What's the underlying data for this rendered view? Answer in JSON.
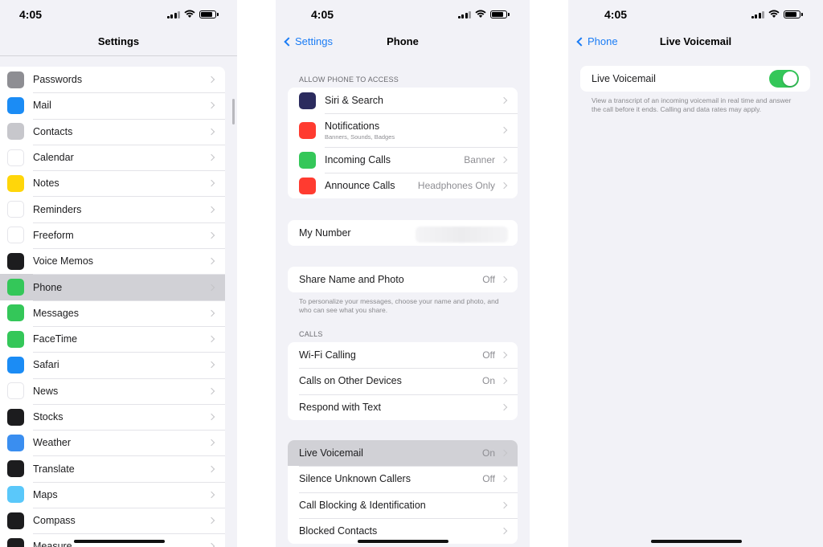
{
  "colors": {
    "accent": "#1a7cf5",
    "toggle_on": "#34c759",
    "highlight": "#d1d1d6"
  },
  "status": {
    "time": "4:05"
  },
  "screen1": {
    "title": "Settings",
    "items": [
      {
        "label": "Passwords",
        "icon": "key-icon",
        "color": "#8e8e93"
      },
      {
        "label": "Mail",
        "icon": "mail-icon",
        "color": "#1b8cf5"
      },
      {
        "label": "Contacts",
        "icon": "contacts-icon",
        "color": "#c7c7cc"
      },
      {
        "label": "Calendar",
        "icon": "calendar-icon",
        "color": "#ffffff"
      },
      {
        "label": "Notes",
        "icon": "notes-icon",
        "color": "#ffd60a"
      },
      {
        "label": "Reminders",
        "icon": "reminders-icon",
        "color": "#ffffff"
      },
      {
        "label": "Freeform",
        "icon": "freeform-icon",
        "color": "#ffffff"
      },
      {
        "label": "Voice Memos",
        "icon": "voice-memos-icon",
        "color": "#1c1c1e"
      },
      {
        "label": "Phone",
        "icon": "phone-icon",
        "color": "#34c759"
      },
      {
        "label": "Messages",
        "icon": "messages-icon",
        "color": "#34c759"
      },
      {
        "label": "FaceTime",
        "icon": "facetime-icon",
        "color": "#34c759"
      },
      {
        "label": "Safari",
        "icon": "safari-icon",
        "color": "#1b8cf5"
      },
      {
        "label": "News",
        "icon": "news-icon",
        "color": "#ffffff"
      },
      {
        "label": "Stocks",
        "icon": "stocks-icon",
        "color": "#1c1c1e"
      },
      {
        "label": "Weather",
        "icon": "weather-icon",
        "color": "#3a8ef0"
      },
      {
        "label": "Translate",
        "icon": "translate-icon",
        "color": "#1c1c1e"
      },
      {
        "label": "Maps",
        "icon": "maps-icon",
        "color": "#5ac8fa"
      },
      {
        "label": "Compass",
        "icon": "compass-icon",
        "color": "#1c1c1e"
      },
      {
        "label": "Measure",
        "icon": "measure-icon",
        "color": "#1c1c1e"
      }
    ]
  },
  "screen2": {
    "back": "Settings",
    "title": "Phone",
    "section_access": "ALLOW PHONE TO ACCESS",
    "access_items": [
      {
        "label": "Siri & Search",
        "icon": "siri-icon",
        "color": "#2b2b5e",
        "value": ""
      },
      {
        "label": "Notifications",
        "sub": "Banners, Sounds, Badges",
        "icon": "notifications-icon",
        "color": "#ff3b30",
        "value": ""
      },
      {
        "label": "Incoming Calls",
        "icon": "incoming-calls-icon",
        "color": "#34c759",
        "value": "Banner"
      },
      {
        "label": "Announce Calls",
        "icon": "announce-calls-icon",
        "color": "#ff3b30",
        "value": "Headphones Only"
      }
    ],
    "my_number": "My Number",
    "share_name": {
      "label": "Share Name and Photo",
      "value": "Off"
    },
    "share_note": "To personalize your messages, choose your name and photo, and who can see what you share.",
    "section_calls": "CALLS",
    "calls_items": [
      {
        "label": "Wi-Fi Calling",
        "value": "Off"
      },
      {
        "label": "Calls on Other Devices",
        "value": "On"
      },
      {
        "label": "Respond with Text",
        "value": ""
      }
    ],
    "vm_items": [
      {
        "label": "Live Voicemail",
        "value": "On"
      },
      {
        "label": "Silence Unknown Callers",
        "value": "Off"
      },
      {
        "label": "Call Blocking & Identification",
        "value": ""
      },
      {
        "label": "Blocked Contacts",
        "value": ""
      }
    ]
  },
  "screen3": {
    "back": "Phone",
    "title": "Live Voicemail",
    "toggle_label": "Live Voicemail",
    "toggle_on": true,
    "note": "View a transcript of an incoming voicemail in real time and answer the call before it ends. Calling and data rates may apply."
  }
}
